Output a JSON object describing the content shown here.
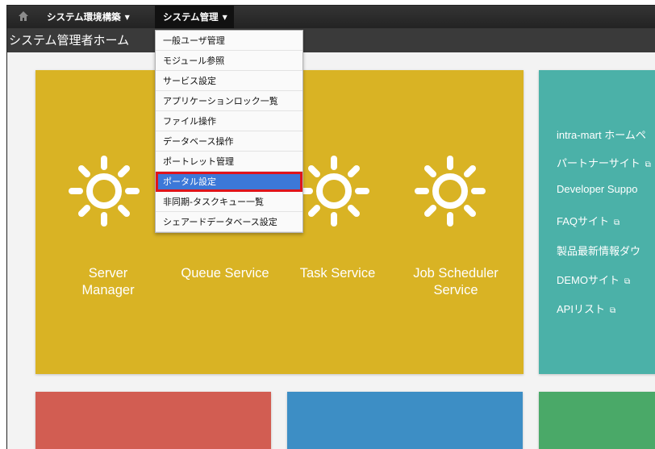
{
  "header": {
    "home_icon": "home-icon",
    "menus": [
      {
        "label": "システム環境構築"
      },
      {
        "label": "システム管理"
      }
    ],
    "caret": "▼"
  },
  "page_title": "システム管理者ホーム",
  "dropdown": {
    "items": [
      {
        "label": "一般ユーザ管理"
      },
      {
        "label": "モジュール参照"
      },
      {
        "label": "サービス設定"
      },
      {
        "label": "アプリケーションロック一覧"
      },
      {
        "label": "ファイル操作"
      },
      {
        "label": "データベース操作"
      },
      {
        "label": "ポートレット管理"
      },
      {
        "label": "ポータル設定",
        "selected": true
      },
      {
        "label": "非同期-タスクキュー一覧"
      },
      {
        "label": "シェアードデータベース設定"
      }
    ]
  },
  "services": [
    {
      "line1": "Server",
      "line2": "Manager"
    },
    {
      "line1": "Queue Service",
      "line2": ""
    },
    {
      "line1": "Task Service",
      "line2": ""
    },
    {
      "line1": "Job Scheduler",
      "line2": "Service"
    }
  ],
  "links": [
    {
      "label": "intra-mart ホームペ"
    },
    {
      "label": "パートナーサイト"
    },
    {
      "label": "Developer Suppo"
    },
    {
      "label": "FAQサイト"
    },
    {
      "label": "製品最新情報ダウ"
    },
    {
      "label": "DEMOサイト"
    },
    {
      "label": "APIリスト"
    }
  ],
  "colors": {
    "yellow_tile": "#d9b324",
    "teal_tile": "#4bb1a8",
    "red_tile": "#d25d52",
    "blue_tile": "#3d8ec5",
    "green_tile": "#4aa968",
    "menu_highlight": "#3c78d8",
    "annotation_border": "#e0141a"
  }
}
